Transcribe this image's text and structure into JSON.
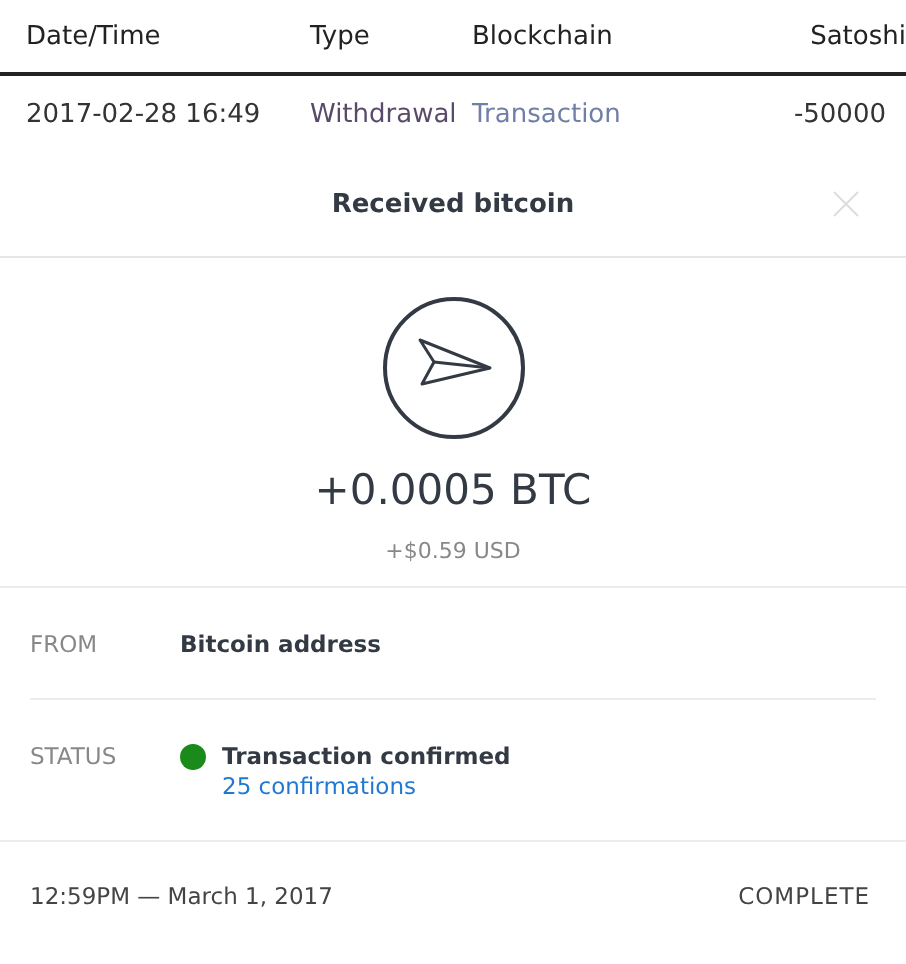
{
  "table": {
    "columns": [
      "Date/Time",
      "Type",
      "Blockchain",
      "Satoshi"
    ],
    "rows": [
      {
        "date_time": "2017-02-28 16:49",
        "type": "Withdrawal",
        "blockchain": "Transaction",
        "satoshi": "-50000"
      }
    ]
  },
  "dialog": {
    "title": "Received bitcoin",
    "amount": "+0.0005 BTC",
    "fiat": "+$0.59 USD",
    "details": [
      {
        "kind": "text",
        "label": "FROM",
        "value": "Bitcoin address"
      },
      {
        "kind": "status",
        "label": "STATUS",
        "value": "Transaction confirmed",
        "link": "25 confirmations",
        "color": "#1a8a1a"
      }
    ],
    "footer": {
      "time": "12:59PM — March 1, 2017",
      "state": "COMPLETE"
    }
  }
}
